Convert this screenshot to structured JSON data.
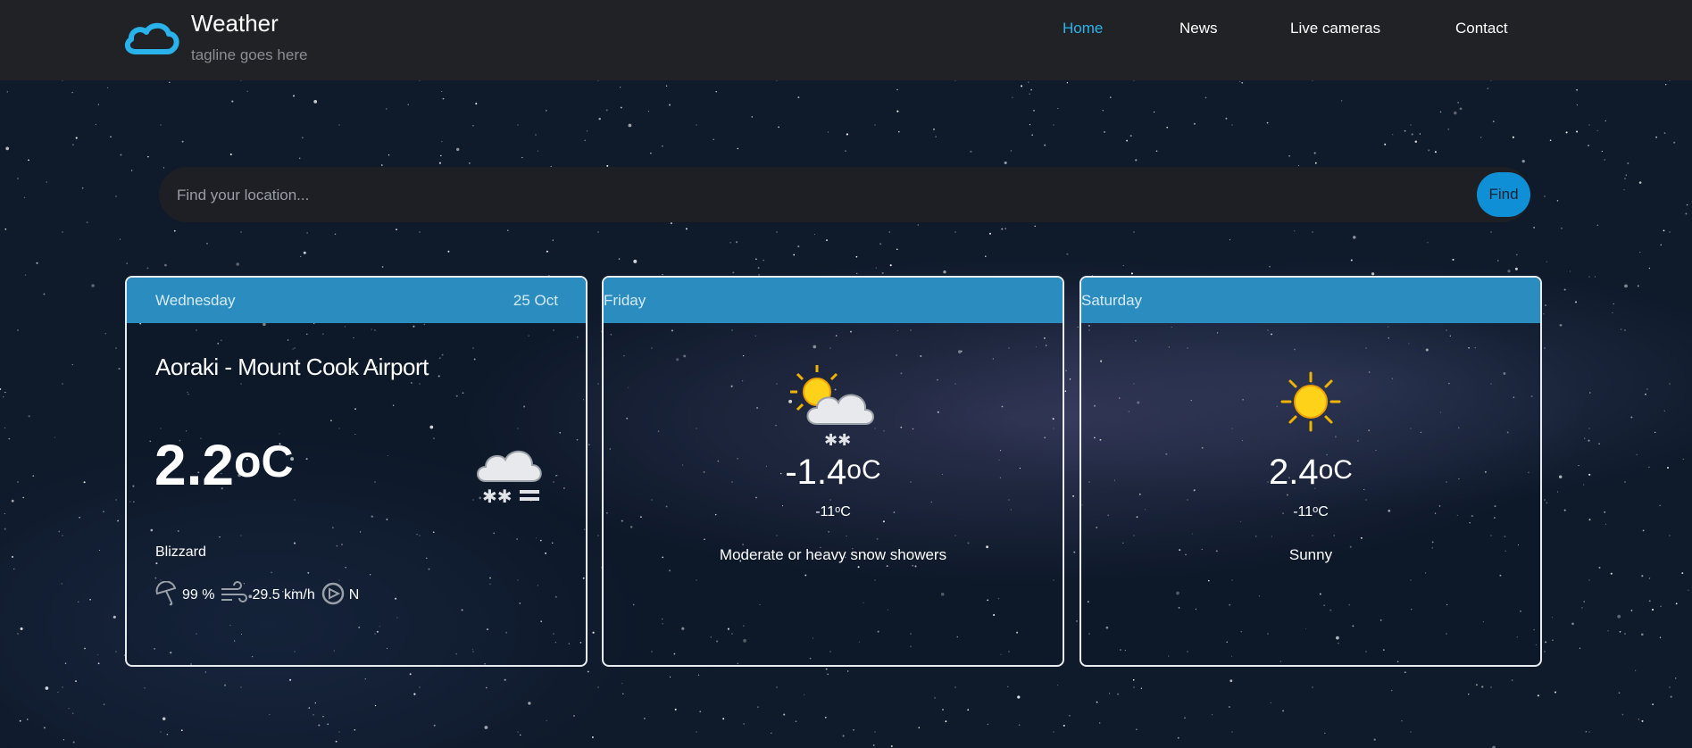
{
  "header": {
    "brand_title": "Weather",
    "tagline": "tagline goes here",
    "accent_color": "#2ab3ea",
    "logo_icon": "cloud-icon",
    "nav": [
      {
        "label": "Home",
        "active": true
      },
      {
        "label": "News",
        "active": false
      },
      {
        "label": "Live cameras",
        "active": false
      },
      {
        "label": "Contact",
        "active": false
      }
    ]
  },
  "search": {
    "placeholder": "Find your location...",
    "button_label": "Find"
  },
  "today": {
    "day": "Wednesday",
    "date": "25 Oct",
    "location": "Aoraki - Mount Cook Airport",
    "temp": "2.2",
    "unit": "oC",
    "condition": "Blizzard",
    "icon": "blizzard-icon",
    "humidity": "99 %",
    "wind_speed": "29.5 km/h",
    "wind_dir": "N"
  },
  "forecast": [
    {
      "day": "Friday",
      "max": "-1.4",
      "unit": "oC",
      "min": "-11",
      "min_unit": "o",
      "min_unit_suffix": "C",
      "condition": "Moderate or heavy snow showers",
      "icon": "sun-cloud-snow-icon"
    },
    {
      "day": "Saturday",
      "max": "2.4",
      "unit": "oC",
      "min": "-11",
      "min_unit": "o",
      "min_unit_suffix": "C",
      "condition": "Sunny",
      "icon": "sun-icon"
    }
  ]
}
